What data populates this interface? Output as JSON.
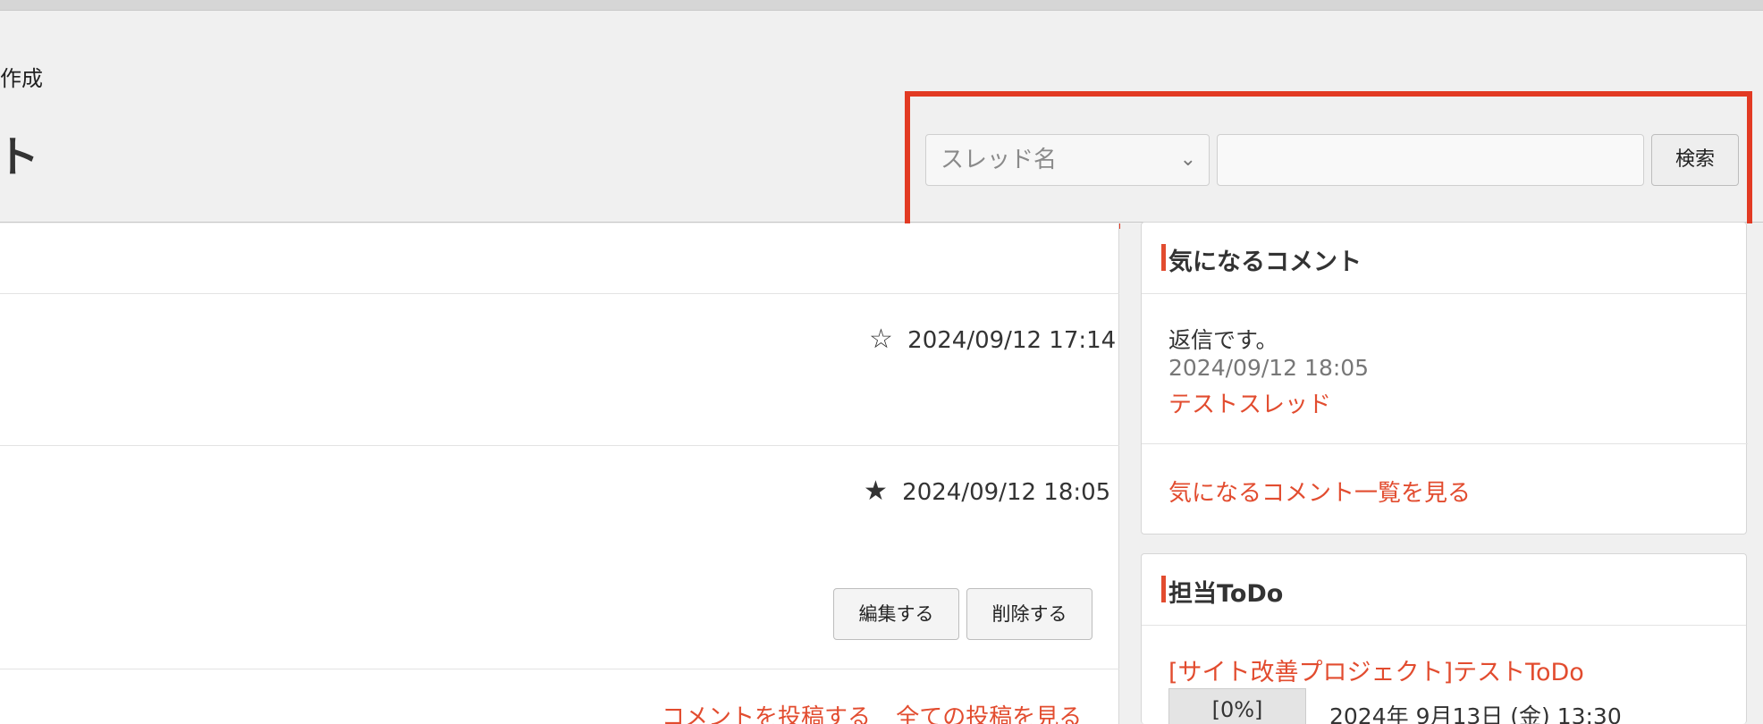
{
  "header": {
    "create_label": "作成",
    "title": "ト"
  },
  "search": {
    "selected_option": "スレッド名",
    "input_value": "",
    "button_label": "検索"
  },
  "posts": [
    {
      "date": "2024/09/12 17:14",
      "starred": false,
      "star_glyph": "☆"
    },
    {
      "date": "2024/09/12 18:05",
      "starred": true,
      "star_glyph": "★"
    }
  ],
  "actions": {
    "edit_label": "編集する",
    "delete_label": "削除する",
    "comment_label": "コメントを投稿する",
    "all_posts_label": "全ての投稿を見る"
  },
  "sidebar": {
    "interesting_comments": {
      "title": "気になるコメント",
      "comment_text": "返信です。",
      "comment_time": "2024/09/12 18:05",
      "thread_link": "テストスレッド",
      "more_link": "気になるコメント一覧を見る"
    },
    "todo": {
      "title": "担当ToDo",
      "item_title": "[サイト改善プロジェクト]テストToDo",
      "progress": "[0%]",
      "date": "2024年 9月13日 (金) 13:30"
    }
  },
  "colors": {
    "accent": "#e24c2f",
    "highlight_border": "#e23a23"
  }
}
